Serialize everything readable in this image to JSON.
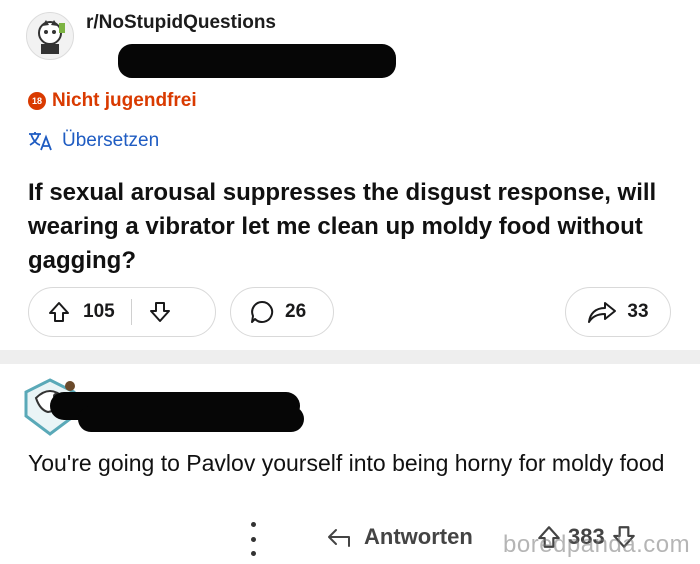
{
  "subreddit": {
    "name": "r/NoStupidQuestions"
  },
  "post": {
    "nsfw_badge": "18",
    "nsfw_label": "Nicht jugendfrei",
    "translate_label": "Übersetzen",
    "title": "If sexual arousal suppresses the disgust response, will wearing a vibrator let me clean up moldy food without gagging?",
    "upvotes": "105",
    "comments": "26",
    "shares": "33"
  },
  "comment": {
    "text": "You're going to Pavlov yourself into being horny for moldy food",
    "reply_label": "Antworten",
    "votes": "383"
  },
  "watermark": "boredpanda.com",
  "colors": {
    "nsfw": "#d93a00",
    "link": "#1f5cc2"
  }
}
